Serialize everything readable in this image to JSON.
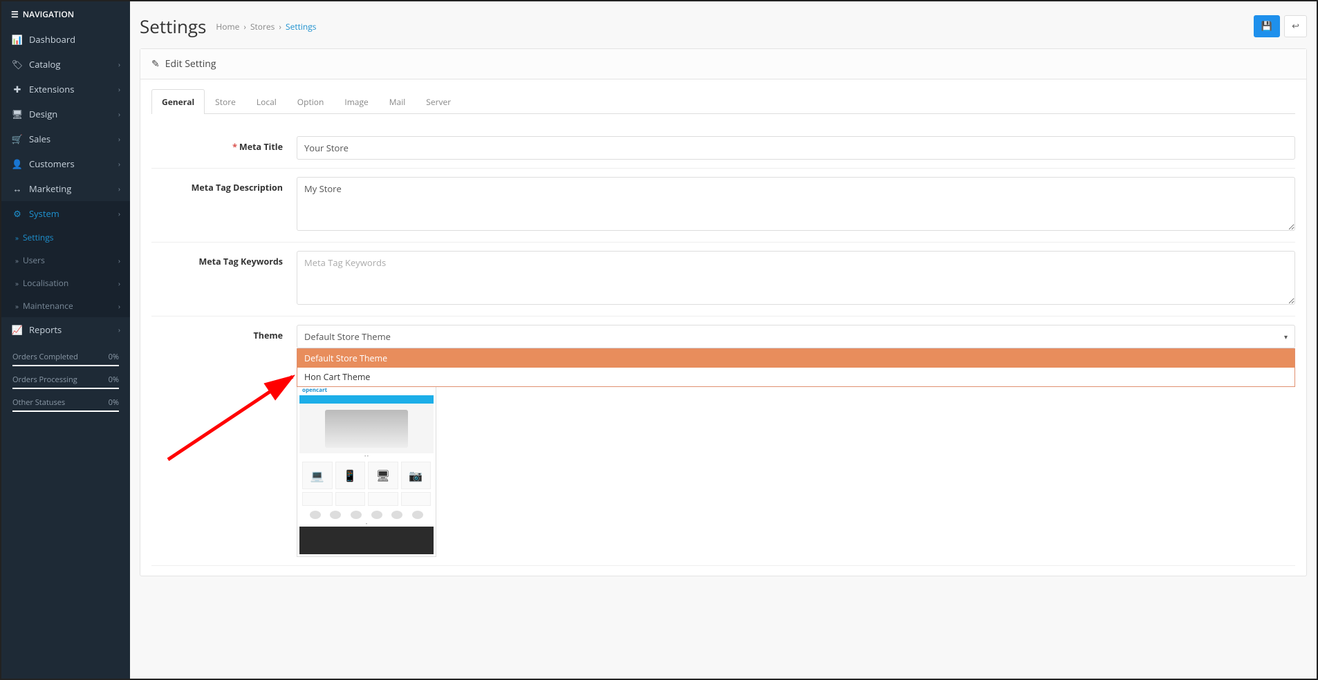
{
  "sidebar": {
    "title": "NAVIGATION",
    "items": [
      {
        "icon": "📊",
        "label": "Dashboard",
        "expandable": false
      },
      {
        "icon": "🏷",
        "label": "Catalog",
        "expandable": true
      },
      {
        "icon": "✚",
        "label": "Extensions",
        "expandable": true
      },
      {
        "icon": "🖥",
        "label": "Design",
        "expandable": true
      },
      {
        "icon": "🛒",
        "label": "Sales",
        "expandable": true
      },
      {
        "icon": "👤",
        "label": "Customers",
        "expandable": true
      },
      {
        "icon": "↔",
        "label": "Marketing",
        "expandable": true
      },
      {
        "icon": "⚙",
        "label": "System",
        "expandable": true,
        "active": true,
        "sub": [
          {
            "label": "Settings",
            "active": true
          },
          {
            "label": "Users",
            "expandable": true
          },
          {
            "label": "Localisation",
            "expandable": true
          },
          {
            "label": "Maintenance",
            "expandable": true
          }
        ]
      },
      {
        "icon": "📈",
        "label": "Reports",
        "expandable": true
      }
    ],
    "stats": [
      {
        "label": "Orders Completed",
        "value": "0%"
      },
      {
        "label": "Orders Processing",
        "value": "0%"
      },
      {
        "label": "Other Statuses",
        "value": "0%"
      }
    ]
  },
  "page": {
    "title": "Settings",
    "breadcrumb": [
      "Home",
      "Stores",
      "Settings"
    ],
    "panel_title": "Edit Setting"
  },
  "tabs": [
    "General",
    "Store",
    "Local",
    "Option",
    "Image",
    "Mail",
    "Server"
  ],
  "form": {
    "meta_title": {
      "label": "Meta Title",
      "value": "Your Store",
      "required": true
    },
    "meta_desc": {
      "label": "Meta Tag Description",
      "value": "My Store"
    },
    "meta_keywords": {
      "label": "Meta Tag Keywords",
      "placeholder": "Meta Tag Keywords"
    },
    "theme": {
      "label": "Theme",
      "selected": "Default Store Theme",
      "options": [
        "Default Store Theme",
        "Hon Cart Theme"
      ]
    }
  }
}
